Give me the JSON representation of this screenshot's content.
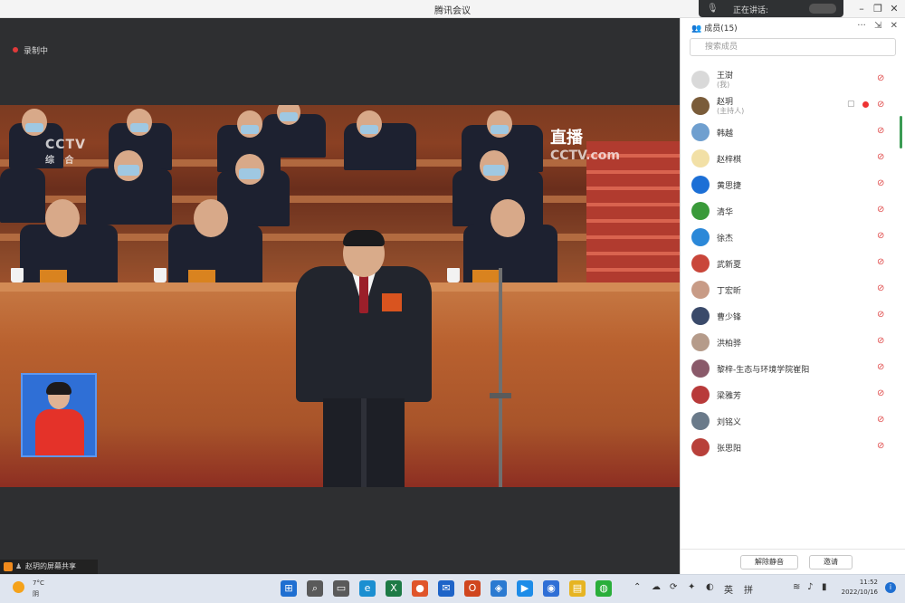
{
  "window": {
    "title": "腾讯会议"
  },
  "speaking": {
    "label": "正在讲话:"
  },
  "recording": {
    "label": "录制中"
  },
  "video": {
    "channel_logo": "CCTV",
    "channel_sub": "综 合",
    "live_tag": "直播",
    "watermark": "CCTV.com"
  },
  "panel": {
    "title": "成员(15)",
    "search_placeholder": "搜索成员",
    "participants": [
      {
        "name": "王澍",
        "sub": "(我)",
        "avatar_color": "#d9d9d9",
        "muted": true
      },
      {
        "name": "赵玥",
        "sub": "(主持人)",
        "avatar_color": "#7a5c3a",
        "muted": true,
        "camera": true
      },
      {
        "name": "韩越",
        "avatar_color": "#6f9fcf",
        "muted": true
      },
      {
        "name": "赵梓棋",
        "avatar_color": "#f2e0a6",
        "muted": true
      },
      {
        "name": "黄思捷",
        "avatar_color": "#1c6fd6",
        "muted": true
      },
      {
        "name": "清华",
        "avatar_color": "#3a9a3a",
        "muted": true
      },
      {
        "name": "徐杰",
        "avatar_color": "#2b88d8",
        "muted": true
      },
      {
        "name": "武新夏",
        "avatar_color": "#c9463a",
        "muted": true
      },
      {
        "name": "丁宏昕",
        "avatar_color": "#c89b86",
        "muted": true
      },
      {
        "name": "曹少锋",
        "avatar_color": "#3a4a6a",
        "muted": true
      },
      {
        "name": "洪柏骅",
        "avatar_color": "#b59b8a",
        "muted": true
      },
      {
        "name": "黎梓-生态与环境学院崔阳",
        "avatar_color": "#8a5a6a",
        "muted": true
      },
      {
        "name": "梁雅芳",
        "avatar_color": "#b83a3a",
        "muted": true
      },
      {
        "name": "刘铭义",
        "avatar_color": "#6a7a8a",
        "muted": true
      },
      {
        "name": "张思阳",
        "avatar_color": "#b8403a",
        "muted": true
      }
    ],
    "footer": {
      "unmute_all": "解除静音",
      "invite": "邀请"
    }
  },
  "taskbar": {
    "notification": "赵玥的屏幕共享",
    "weather_temp": "7°C",
    "weather_cond": "阴",
    "ime": "英",
    "ime2": "拼",
    "time": "11:52",
    "date": "2022/10/16",
    "icons": [
      {
        "name": "start-icon",
        "glyph": "⊞",
        "color": "#1f6fd1"
      },
      {
        "name": "search-icon",
        "glyph": "⌕",
        "color": "#5a5a5a"
      },
      {
        "name": "task-view-icon",
        "glyph": "▭",
        "color": "#5a5a5a"
      },
      {
        "name": "edge-icon",
        "glyph": "e",
        "color": "#1b8fd1"
      },
      {
        "name": "excel-icon",
        "glyph": "X",
        "color": "#1d7a45"
      },
      {
        "name": "app-icon",
        "glyph": "●",
        "color": "#e0552a"
      },
      {
        "name": "outlook-icon",
        "glyph": "✉",
        "color": "#1e64c8"
      },
      {
        "name": "office-icon",
        "glyph": "O",
        "color": "#d0461f"
      },
      {
        "name": "security-icon",
        "glyph": "◈",
        "color": "#2b7ad1"
      },
      {
        "name": "dingtalk-icon",
        "glyph": "▶",
        "color": "#1d8ce8"
      },
      {
        "name": "meeting-icon",
        "glyph": "◉",
        "color": "#2f6fd6"
      },
      {
        "name": "folder-icon",
        "glyph": "▤",
        "color": "#e6b422"
      },
      {
        "name": "wechat-icon",
        "glyph": "◍",
        "color": "#2aae3a"
      }
    ]
  }
}
